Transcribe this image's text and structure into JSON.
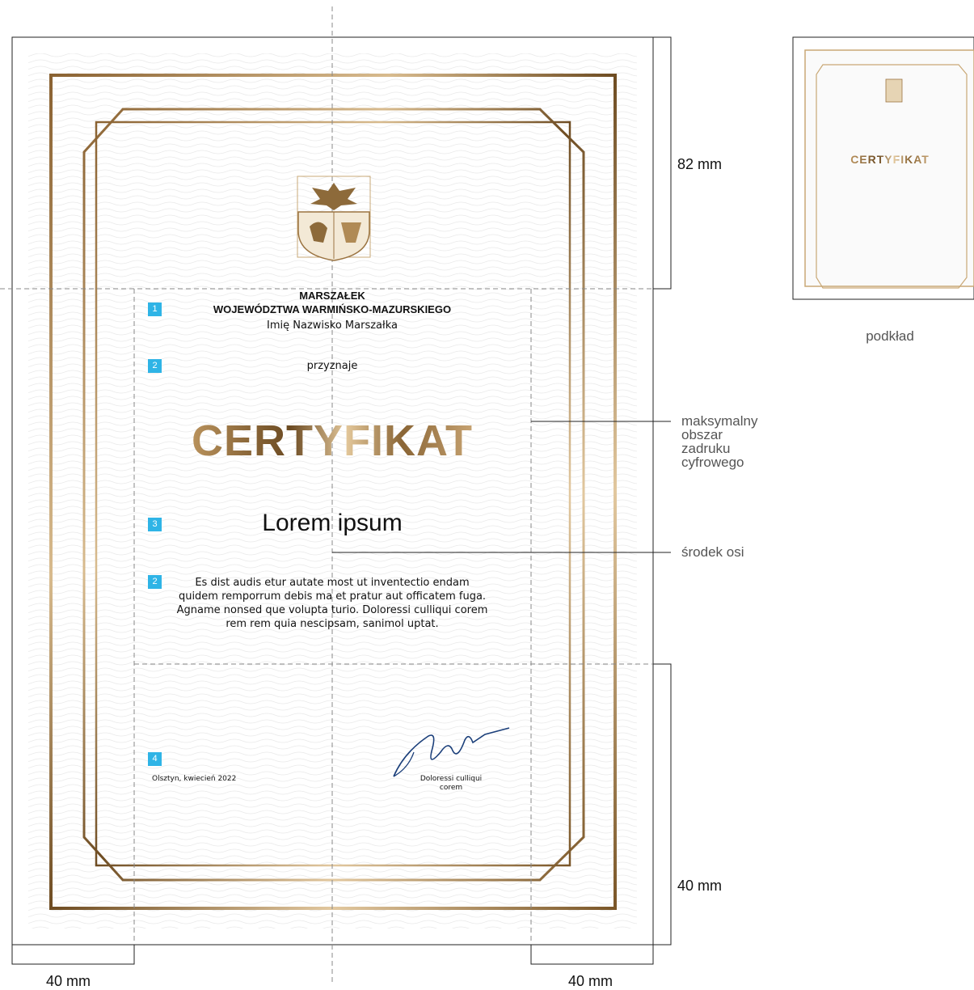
{
  "certificate": {
    "header_line1": "MARSZAŁEK",
    "header_line2": "WOJEWÓDZTWA WARMIŃSKO-MAZURSKIEGO",
    "header_line3": "Imię Nazwisko Marszałka",
    "awards": "przyznaje",
    "title": "CERTYFIKAT",
    "recipient": "Lorem ipsum",
    "body_lines": [
      "Es dist audis etur autate most ut inventectio endam",
      "quidem remporrum debis ma et pratur aut officatem fuga.",
      "Agname nonsed que volupta turio. Doloressi culliqui corem",
      "rem rem quia nescipsam, sanimol uptat."
    ],
    "place_date": "Olsztyn, kwiecień 2022",
    "signatory_line1": "Doloressi culliqui",
    "signatory_line2": "corem"
  },
  "markers": [
    "1",
    "2",
    "3",
    "2",
    "4"
  ],
  "dimensions": {
    "top_margin": "82 mm",
    "bottom_margin": "40 mm",
    "left_margin": "40 mm",
    "right_margin": "40 mm"
  },
  "annotations": {
    "print_area_lines": [
      "maksymalny",
      "obszar",
      "zadruku",
      "cyfrowego"
    ],
    "axis_center": "środek osi"
  },
  "thumbnail": {
    "title": "CERTYFIKAT",
    "caption": "podkład"
  },
  "colors": {
    "gold_dark": "#7a5628",
    "gold_light": "#d9bb8c",
    "marker_blue": "#2fb4e6",
    "signature_blue": "#1b3f7a"
  },
  "icons": [
    "coat-of-arms-icon",
    "signature-icon"
  ]
}
